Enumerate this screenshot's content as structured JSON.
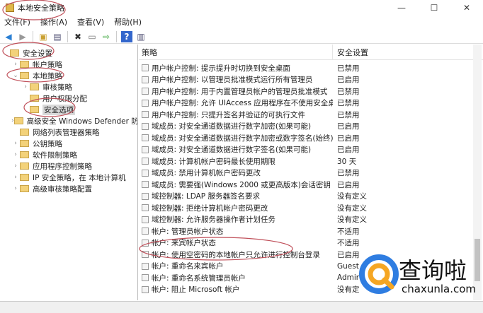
{
  "window": {
    "title": "本地安全策略",
    "controls": [
      "—",
      "☐",
      "✕"
    ]
  },
  "menu": [
    "文件(F)",
    "操作(A)",
    "查看(V)",
    "帮助(H)"
  ],
  "toolbar": [
    "back-icon",
    "forward-icon",
    "up-folder-icon",
    "show-hide-tree-icon",
    "delete-icon",
    "properties-icon",
    "export-icon",
    "help-icon",
    "console-icon"
  ],
  "tree": [
    {
      "label": "安全设置",
      "level": 0,
      "arrow": ""
    },
    {
      "label": "帐户策略",
      "level": 1,
      "arrow": "›"
    },
    {
      "label": "本地策略",
      "level": 1,
      "arrow": "⌄"
    },
    {
      "label": "审核策略",
      "level": 2,
      "arrow": "›"
    },
    {
      "label": "用户权限分配",
      "level": 2,
      "arrow": ""
    },
    {
      "label": "安全选项",
      "level": 2,
      "arrow": "",
      "selected": true
    },
    {
      "label": "高级安全 Windows Defender 防火墙",
      "level": 1,
      "arrow": "›"
    },
    {
      "label": "网络列表管理器策略",
      "level": 1,
      "arrow": ""
    },
    {
      "label": "公钥策略",
      "level": 1,
      "arrow": "›"
    },
    {
      "label": "软件限制策略",
      "level": 1,
      "arrow": "›"
    },
    {
      "label": "应用程序控制策略",
      "level": 1,
      "arrow": "›"
    },
    {
      "label": "IP 安全策略，在 本地计算机",
      "level": 1,
      "arrow": "›"
    },
    {
      "label": "高级审核策略配置",
      "level": 1,
      "arrow": "›"
    }
  ],
  "table": {
    "headers": [
      "策略",
      "安全设置"
    ],
    "rows": [
      [
        "用户帐户控制: 提示提升时切换到安全桌面",
        "已禁用"
      ],
      [
        "用户帐户控制: 以管理员批准模式运行所有管理员",
        "已启用"
      ],
      [
        "用户帐户控制: 用于内置管理员帐户的管理员批准模式",
        "已禁用"
      ],
      [
        "用户帐户控制: 允许 UIAccess 应用程序在不使用安全桌面...",
        "已禁用"
      ],
      [
        "用户帐户控制: 只提升签名并验证的可执行文件",
        "已禁用"
      ],
      [
        "域成员: 对安全通道数据进行数字加密(如果可能)",
        "已启用"
      ],
      [
        "域成员: 对安全通道数据进行数字加密或数字签名(始终)",
        "已启用"
      ],
      [
        "域成员: 对安全通道数据进行数字签名(如果可能)",
        "已启用"
      ],
      [
        "域成员: 计算机帐户密码最长使用期限",
        "30 天"
      ],
      [
        "域成员: 禁用计算机帐户密码更改",
        "已禁用"
      ],
      [
        "域成员: 需要强(Windows 2000 或更高版本)会话密钥",
        "已启用"
      ],
      [
        "域控制器: LDAP 服务器签名要求",
        "没有定义"
      ],
      [
        "域控制器: 拒绝计算机帐户密码更改",
        "没有定义"
      ],
      [
        "域控制器: 允许服务器操作者计划任务",
        "没有定义"
      ],
      [
        "帐户: 管理员帐户状态",
        "不适用"
      ],
      [
        "帐户: 来宾帐户状态",
        "不适用"
      ],
      [
        "帐户: 使用空密码的本地帐户只允许进行控制台登录",
        "已启用"
      ],
      [
        "帐户: 重命名来宾帐户",
        "Guest"
      ],
      [
        "帐户: 重命名系统管理员帐户",
        "Admir"
      ],
      [
        "帐户: 阻止 Microsoft 帐户",
        "没有定"
      ]
    ]
  },
  "watermark": {
    "text": "查询啦",
    "url": "chaxunla.com"
  },
  "colors": {
    "annotation": "#c0505a",
    "logo_blue": "#2f7de1",
    "logo_orange": "#f5a623"
  }
}
